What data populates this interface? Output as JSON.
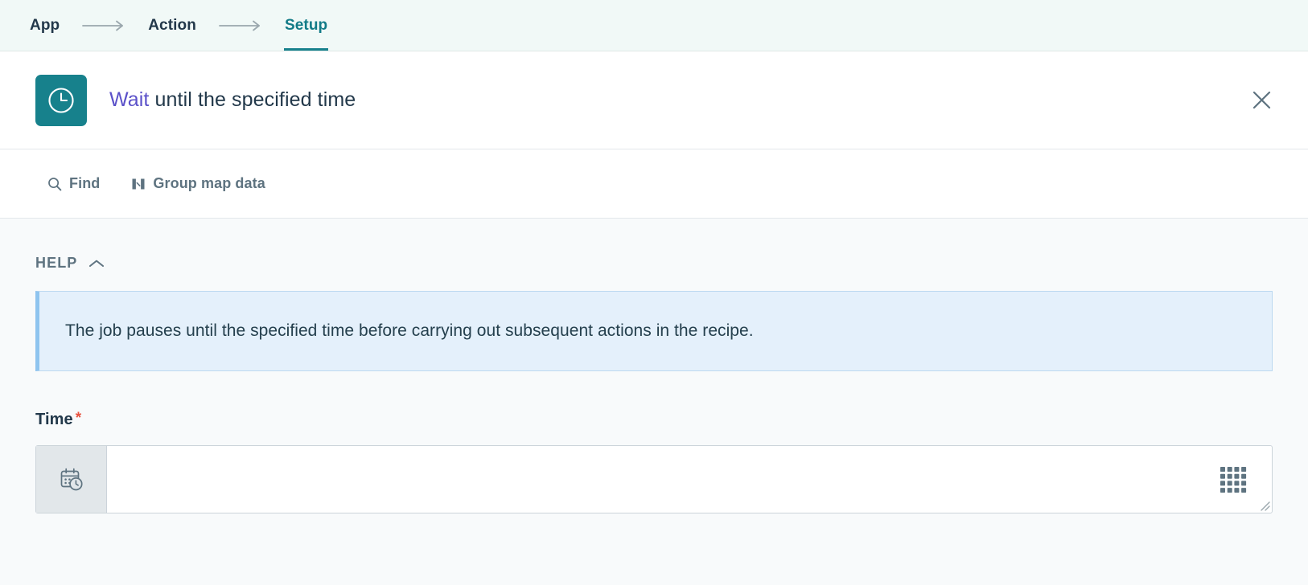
{
  "stepnav": {
    "steps": [
      {
        "label": "App",
        "active": false
      },
      {
        "label": "Action",
        "active": false
      },
      {
        "label": "Setup",
        "active": true
      }
    ],
    "arrow_icon": "arrow-right-icon"
  },
  "action_header": {
    "icon": "clock-icon",
    "app_name": "Wait",
    "title_rest": " until the specified time",
    "close_icon": "close-icon"
  },
  "toolbar": {
    "buttons": [
      {
        "label": "Find",
        "icon": "search-icon"
      },
      {
        "label": "Group map data",
        "icon": "group-map-data-icon"
      }
    ]
  },
  "help": {
    "label": "HELP",
    "chevron_icon": "chevron-up-icon",
    "text": "The job pauses until the specified time before carrying out subsequent actions in the recipe."
  },
  "time_field": {
    "label": "Time",
    "required_marker": "*",
    "prefix_icon": "calendar-clock-icon",
    "value": "",
    "placeholder": "",
    "pills_icon": "data-pills-grid-icon",
    "resize_icon": "resize-handle-icon"
  },
  "colors": {
    "accent_teal": "#17818c",
    "app_name_purple": "#5b51c9",
    "nav_background": "#f1f9f7",
    "body_background": "#f8fafb",
    "help_banner_bg": "#e4f0fb",
    "help_banner_border": "#8fc4ef",
    "required_red": "#e8523f",
    "muted_text": "#5e7380",
    "dark_text": "#22384a"
  }
}
